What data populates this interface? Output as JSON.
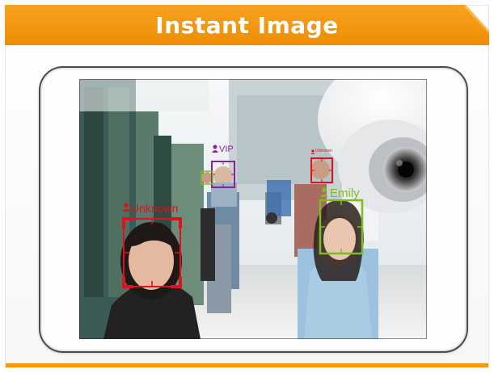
{
  "header": {
    "title": "Instant Image"
  },
  "colors": {
    "header_orange": "#f39a0d",
    "unknown_red": "#e0101c",
    "vip_purple": "#8b1fa0",
    "emily_green": "#7dbd1f"
  },
  "detections": [
    {
      "id": "unknown-left",
      "label": "Unknown",
      "color": "#e0101c",
      "icon": "person-icon"
    },
    {
      "id": "vip",
      "label": "VIP",
      "color": "#8b1fa0",
      "icon": "person-icon"
    },
    {
      "id": "unknown-back",
      "label": "Unknown",
      "color": "#e0101c",
      "icon": "person-icon"
    },
    {
      "id": "emily",
      "label": "Emily",
      "color": "#7dbd1f",
      "icon": "person-icon"
    }
  ]
}
